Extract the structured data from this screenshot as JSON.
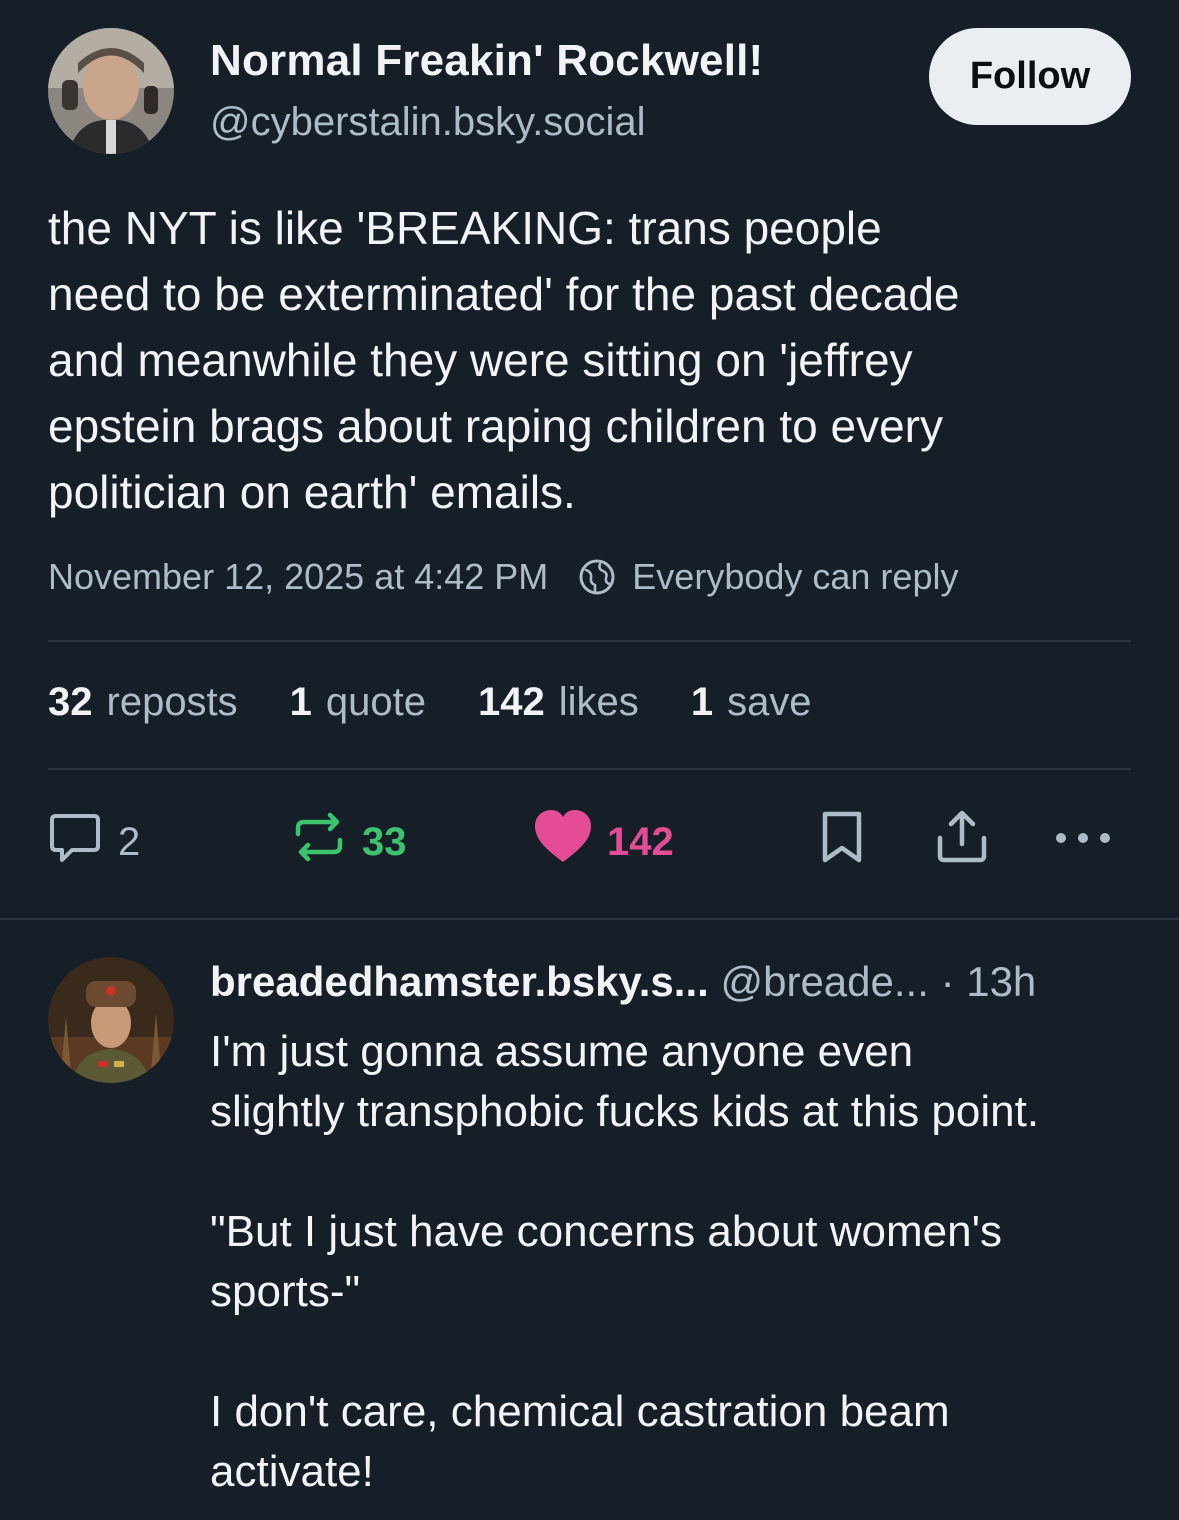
{
  "post": {
    "author_name": "Normal Freakin' Rockwell!",
    "author_handle": "@cyberstalin.bsky.social",
    "follow_label": "Follow",
    "text_lines": [
      "the NYT is like 'BREAKING: trans people",
      "need to be exterminated' for the past decade",
      "and meanwhile they were sitting on 'jeffrey",
      "epstein brags about raping children to every",
      "politician on earth' emails."
    ],
    "timestamp": "November 12, 2025 at 4:42 PM",
    "reply_setting": "Everybody can reply",
    "stats": {
      "reposts_count": "32",
      "reposts_label": "reposts",
      "quotes_count": "1",
      "quotes_label": "quote",
      "likes_count": "142",
      "likes_label": "likes",
      "saves_count": "1",
      "saves_label": "save"
    },
    "actions": {
      "reply_count": "2",
      "repost_count": "33",
      "like_count": "142"
    },
    "colors": {
      "background": "#161e27",
      "repost_active": "#3bc46d",
      "like_active": "#e44d95",
      "muted": "#aebbc9"
    }
  },
  "reply": {
    "author_name": "breadedhamster.bsky.s...",
    "author_handle": "@breade...",
    "time": "· 13h",
    "text_lines": [
      "I'm just gonna assume anyone even",
      "slightly transphobic fucks kids at this point.",
      "",
      "\"But I just have concerns about women's",
      "sports-\"",
      "",
      "I don't care, chemical castration beam",
      "activate!"
    ]
  },
  "icons": {
    "reply": "speech-bubble-icon",
    "repost": "repost-arrows-icon",
    "like": "heart-icon",
    "save": "bookmark-icon",
    "share": "share-icon",
    "more": "ellipsis-icon",
    "reply_setting": "globe-icon"
  }
}
